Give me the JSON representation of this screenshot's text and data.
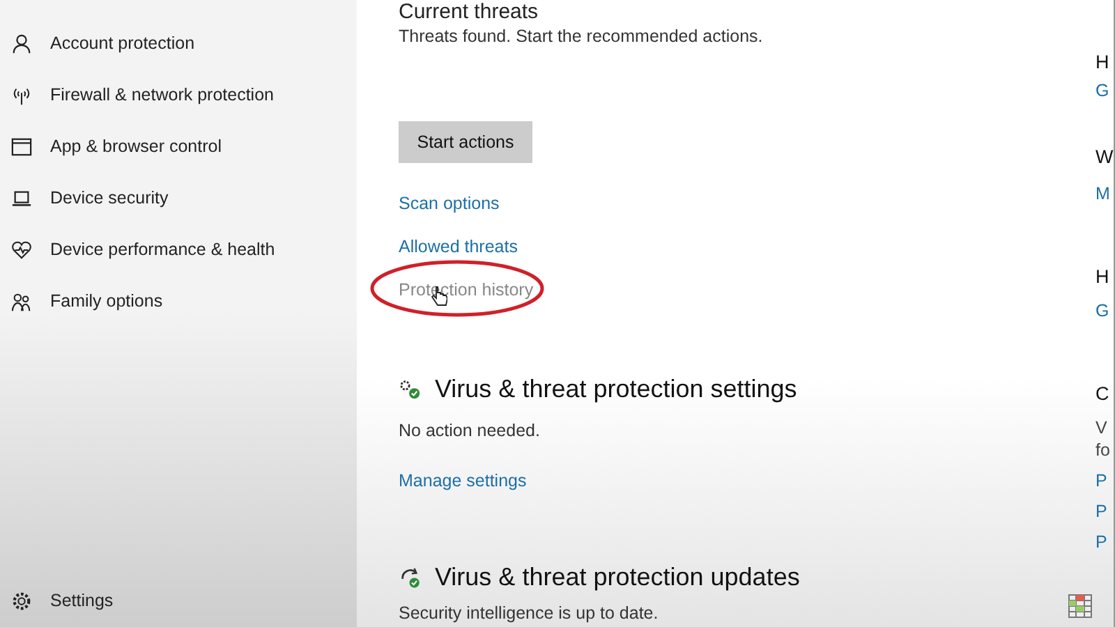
{
  "sidebar": {
    "items": [
      {
        "label": "Account protection"
      },
      {
        "label": "Firewall & network protection"
      },
      {
        "label": "App & browser control"
      },
      {
        "label": "Device security"
      },
      {
        "label": "Device performance & health"
      },
      {
        "label": "Family options"
      }
    ],
    "settings": "Settings"
  },
  "current_threats": {
    "title": "Current threats",
    "message": "Threats found. Start the recommended actions.",
    "button": "Start actions",
    "links": [
      {
        "label": "Scan options",
        "circled": false
      },
      {
        "label": "Allowed threats",
        "circled": false
      },
      {
        "label": "Protection history",
        "circled": true
      }
    ]
  },
  "settings_section": {
    "title": "Virus & threat protection settings",
    "message": "No action needed.",
    "link": "Manage settings"
  },
  "updates_section": {
    "title": "Virus & threat protection updates",
    "message": "Security intelligence is up to date."
  },
  "right_column": [
    {
      "text": "H",
      "kind": "heading"
    },
    {
      "text": "G",
      "kind": "link"
    },
    {
      "text": "W",
      "kind": "heading"
    },
    {
      "text": "M",
      "kind": "link"
    },
    {
      "text": "H",
      "kind": "heading"
    },
    {
      "text": "G",
      "kind": "link"
    },
    {
      "text": "C",
      "kind": "heading"
    },
    {
      "text": "V",
      "kind": "text"
    },
    {
      "text": "fo",
      "kind": "text"
    },
    {
      "text": "P",
      "kind": "link"
    },
    {
      "text": "P",
      "kind": "link"
    },
    {
      "text": "P",
      "kind": "link"
    }
  ]
}
